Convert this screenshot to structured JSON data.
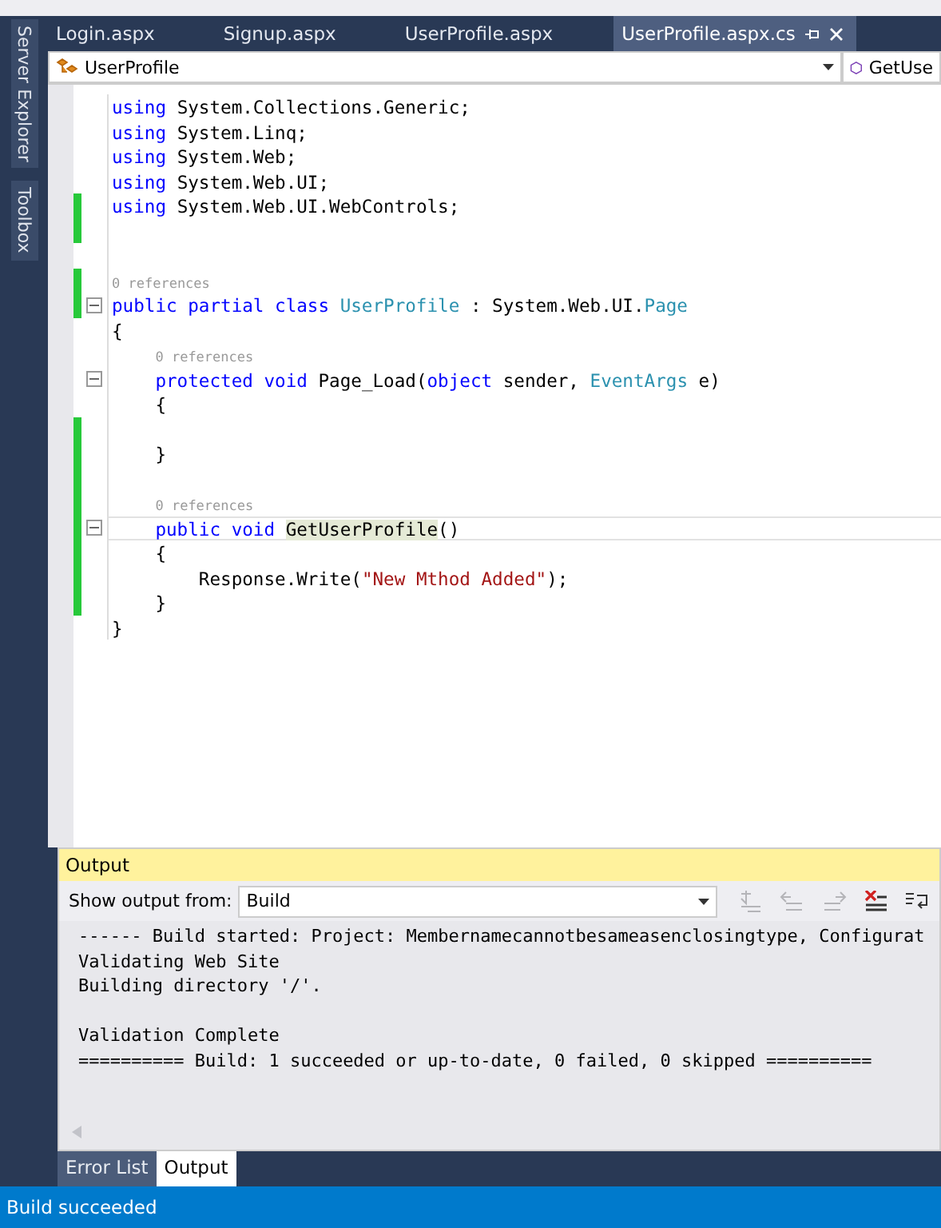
{
  "side_tool_tabs": [
    "Server Explorer",
    "Toolbox"
  ],
  "document_tabs": [
    {
      "label": "Login.aspx",
      "selected": false
    },
    {
      "label": "Signup.aspx",
      "selected": false
    },
    {
      "label": "UserProfile.aspx",
      "selected": false
    },
    {
      "label": "UserProfile.aspx.cs",
      "selected": true
    }
  ],
  "navigation_bar": {
    "type_dropdown": "UserProfile",
    "member_dropdown": "GetUse"
  },
  "code_lines": [
    {
      "kind": "code",
      "changed": false,
      "current": false,
      "tokens": [
        {
          "text": "using ",
          "kind": "keyword"
        },
        {
          "text": "System.Collections.Generic;",
          "kind": "plain"
        }
      ]
    },
    {
      "kind": "code",
      "changed": false,
      "current": false,
      "tokens": [
        {
          "text": "using ",
          "kind": "keyword"
        },
        {
          "text": "System.Linq;",
          "kind": "plain"
        }
      ]
    },
    {
      "kind": "code",
      "changed": false,
      "current": false,
      "tokens": [
        {
          "text": "using ",
          "kind": "keyword"
        },
        {
          "text": "System.Web;",
          "kind": "plain"
        }
      ]
    },
    {
      "kind": "code",
      "changed": false,
      "current": false,
      "tokens": [
        {
          "text": "using ",
          "kind": "keyword"
        },
        {
          "text": "System.Web.UI;",
          "kind": "plain"
        }
      ]
    },
    {
      "kind": "code",
      "changed": true,
      "current": false,
      "tokens": [
        {
          "text": "using ",
          "kind": "keyword"
        },
        {
          "text": "System.Web.UI.WebControls;",
          "kind": "plain"
        }
      ]
    },
    {
      "kind": "blank",
      "changed": true,
      "current": false
    },
    {
      "kind": "blank",
      "changed": false,
      "current": false
    },
    {
      "kind": "hint",
      "changed": true,
      "current": false,
      "text": "0 references"
    },
    {
      "kind": "code",
      "changed": true,
      "current": false,
      "fold": true,
      "tokens": [
        {
          "text": "public partial class ",
          "kind": "keyword"
        },
        {
          "text": "UserProfile",
          "kind": "type"
        },
        {
          "text": " : System.Web.UI.",
          "kind": "plain"
        },
        {
          "text": "Page",
          "kind": "type"
        }
      ]
    },
    {
      "kind": "code",
      "changed": false,
      "current": false,
      "tokens": [
        {
          "text": "{",
          "kind": "plain"
        }
      ]
    },
    {
      "kind": "hint",
      "changed": false,
      "current": false,
      "text": "    0 references"
    },
    {
      "kind": "code",
      "changed": false,
      "current": false,
      "fold": true,
      "tokens": [
        {
          "text": "    protected void ",
          "kind": "keyword"
        },
        {
          "text": "Page_Load(",
          "kind": "plain"
        },
        {
          "text": "object",
          "kind": "keyword"
        },
        {
          "text": " sender, ",
          "kind": "plain"
        },
        {
          "text": "EventArgs",
          "kind": "type"
        },
        {
          "text": " e)",
          "kind": "plain"
        }
      ]
    },
    {
      "kind": "code",
      "changed": false,
      "current": false,
      "tokens": [
        {
          "text": "    {",
          "kind": "plain"
        }
      ]
    },
    {
      "kind": "blank",
      "changed": true,
      "current": false
    },
    {
      "kind": "code",
      "changed": true,
      "current": false,
      "tokens": [
        {
          "text": "    }",
          "kind": "plain"
        }
      ]
    },
    {
      "kind": "blank",
      "changed": true,
      "current": false
    },
    {
      "kind": "hint",
      "changed": true,
      "current": false,
      "text": "    0 references"
    },
    {
      "kind": "code",
      "changed": true,
      "current": true,
      "fold": true,
      "tokens": [
        {
          "text": "    public void ",
          "kind": "keyword"
        },
        {
          "text": "GetUserProfile",
          "kind": "reference"
        },
        {
          "text": "()",
          "kind": "plain"
        }
      ]
    },
    {
      "kind": "code",
      "changed": true,
      "current": false,
      "tokens": [
        {
          "text": "    {",
          "kind": "plain"
        }
      ]
    },
    {
      "kind": "code",
      "changed": true,
      "current": false,
      "tokens": [
        {
          "text": "        Response.Write(",
          "kind": "plain"
        },
        {
          "text": "\"New Mthod Added\"",
          "kind": "string"
        },
        {
          "text": ");",
          "kind": "plain"
        }
      ]
    },
    {
      "kind": "code",
      "changed": true,
      "current": false,
      "tokens": [
        {
          "text": "    }",
          "kind": "plain"
        }
      ]
    },
    {
      "kind": "code",
      "changed": false,
      "current": false,
      "tokens": [
        {
          "text": "}",
          "kind": "plain"
        }
      ]
    }
  ],
  "output_panel": {
    "title": "Output",
    "source_label": "Show output from:",
    "source_value": "Build",
    "toolbar": [
      {
        "kind": "goto",
        "disabled": true
      },
      {
        "kind": "previous",
        "disabled": true
      },
      {
        "kind": "next",
        "disabled": true
      },
      {
        "kind": "clear",
        "disabled": false
      },
      {
        "kind": "wrap",
        "disabled": false
      }
    ],
    "line_groups": [
      [
        "------ Build started: Project: Membernamecannotbesameasenclosingtype, Configurat",
        "Validating Web Site",
        "Building directory '/'."
      ],
      [
        "Validation Complete",
        "========== Build: 1 succeeded or up-to-date, 0 failed, 0 skipped =========="
      ]
    ]
  },
  "bottom_tabs": [
    {
      "label": "Error List",
      "selected": false
    },
    {
      "label": "Output",
      "selected": true
    }
  ],
  "status_bar": "Build succeeded"
}
